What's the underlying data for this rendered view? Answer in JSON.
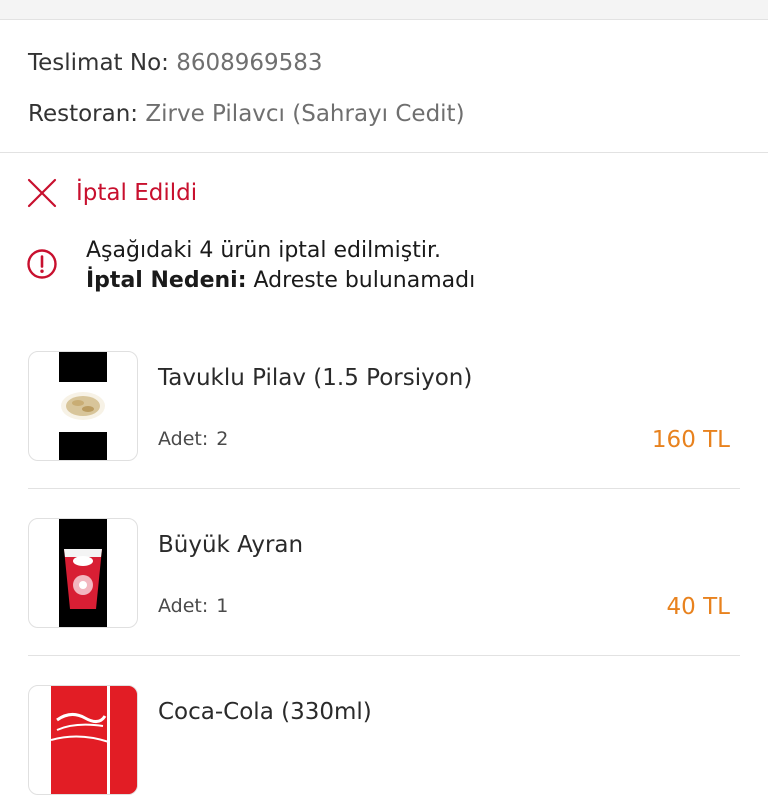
{
  "delivery": {
    "number_label": "Teslimat No:",
    "number_value": "8608969583",
    "restaurant_label": "Restoran:",
    "restaurant_value": "Zirve Pilavcı (Sahrayı Cedit)"
  },
  "status": {
    "label": "İptal Edildi",
    "icon": "close-icon",
    "color": "#c8102e"
  },
  "notice": {
    "line1": "Aşağıdaki 4 ürün iptal edilmiştir.",
    "reason_label": "İptal Nedeni:",
    "reason_value": "Adreste bulunamadı",
    "icon": "info-circle-icon"
  },
  "items": [
    {
      "name": "Tavuklu Pilav (1.5 Porsiyon)",
      "qty_label": "Adet:",
      "qty": "2",
      "price": "160 TL",
      "image": "rice-photo"
    },
    {
      "name": "Büyük Ayran",
      "qty_label": "Adet:",
      "qty": "1",
      "price": "40 TL",
      "image": "ayran-cup-photo"
    },
    {
      "name": "Coca-Cola (330ml)",
      "qty_label": "Adet:",
      "qty": "",
      "price": "",
      "image": "coca-cola-can-photo"
    }
  ],
  "colors": {
    "price": "#e8821e",
    "cancel": "#c8102e",
    "divider": "#e2e2e2"
  }
}
